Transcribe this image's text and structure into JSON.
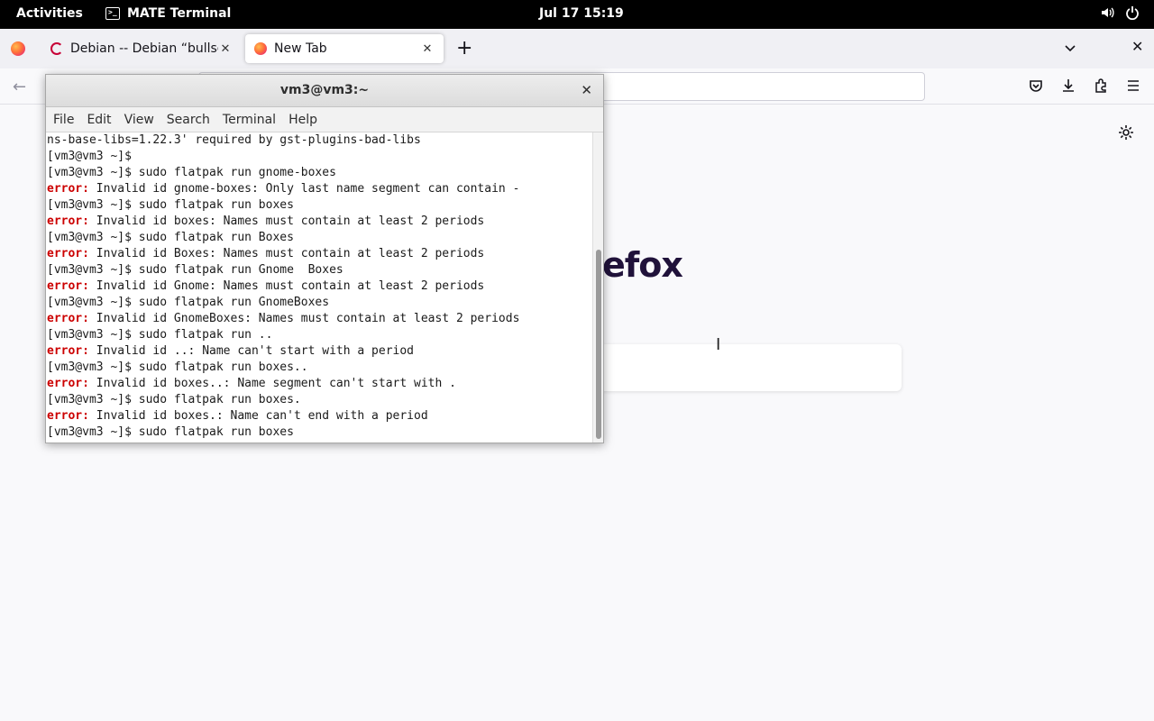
{
  "topbar": {
    "activities": "Activities",
    "app_name": "MATE Terminal",
    "clock": "Jul 17  15:19"
  },
  "firefox": {
    "tabs": [
      {
        "label": "Debian -- Debian “bullseye”",
        "active": false
      },
      {
        "label": "New Tab",
        "active": true
      }
    ],
    "brand_fragment": "efox"
  },
  "terminal": {
    "title": "vm3@vm3:~",
    "menu": [
      "File",
      "Edit",
      "View",
      "Search",
      "Terminal",
      "Help"
    ],
    "lines": [
      {
        "text": "ns-base-libs=1.22.3' required by gst-plugins-bad-libs"
      },
      {
        "text": "[vm3@vm3 ~]$"
      },
      {
        "text": "[vm3@vm3 ~]$ sudo flatpak run gnome-boxes"
      },
      {
        "err": "error:",
        "text": " Invalid id gnome-boxes: Only last name segment can contain -"
      },
      {
        "text": "[vm3@vm3 ~]$ sudo flatpak run boxes"
      },
      {
        "err": "error:",
        "text": " Invalid id boxes: Names must contain at least 2 periods"
      },
      {
        "text": "[vm3@vm3 ~]$ sudo flatpak run Boxes"
      },
      {
        "err": "error:",
        "text": " Invalid id Boxes: Names must contain at least 2 periods"
      },
      {
        "text": "[vm3@vm3 ~]$ sudo flatpak run Gnome  Boxes"
      },
      {
        "err": "error:",
        "text": " Invalid id Gnome: Names must contain at least 2 periods"
      },
      {
        "text": "[vm3@vm3 ~]$ sudo flatpak run GnomeBoxes"
      },
      {
        "err": "error:",
        "text": " Invalid id GnomeBoxes: Names must contain at least 2 periods"
      },
      {
        "text": "[vm3@vm3 ~]$ sudo flatpak run .."
      },
      {
        "err": "error:",
        "text": " Invalid id ..: Name can't start with a period"
      },
      {
        "text": "[vm3@vm3 ~]$ sudo flatpak run boxes.."
      },
      {
        "err": "error:",
        "text": " Invalid id boxes..: Name segment can't start with ."
      },
      {
        "text": "[vm3@vm3 ~]$ sudo flatpak run boxes."
      },
      {
        "err": "error:",
        "text": " Invalid id boxes.: Name can't end with a period"
      },
      {
        "text": "[vm3@vm3 ~]$ sudo flatpak run boxes"
      }
    ]
  }
}
